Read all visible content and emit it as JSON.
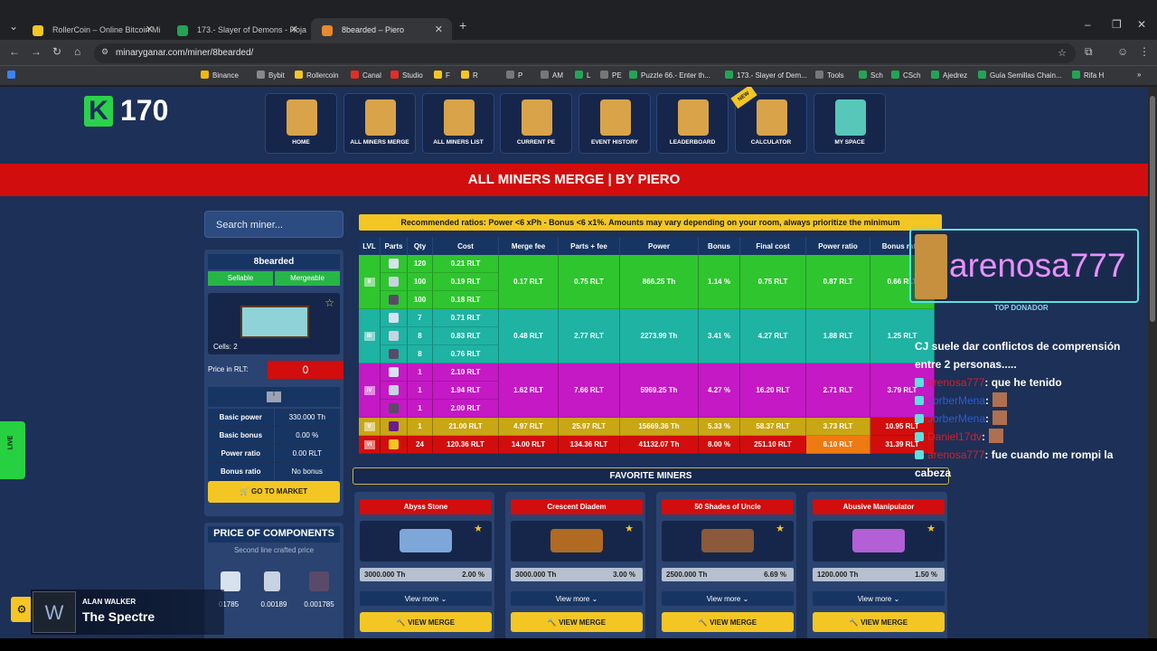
{
  "browser": {
    "tabs": [
      {
        "label": "RollerCoin – Online Bitcoin Mi",
        "color": "#f3c623"
      },
      {
        "label": "173.- Slayer of Demons - Hoja",
        "color": "#23a455"
      },
      {
        "label": "8bearded – Piero",
        "color": "#e8892f"
      }
    ],
    "url": "minaryganar.com/miner/8bearded/",
    "bookmarks": [
      "Binance",
      "Bybit",
      "Rollercoin",
      "Canal",
      "Studio",
      "F",
      "R",
      "P",
      "AM",
      "L",
      "PE",
      "Puzzle 66.- Enter th...",
      "173.- Slayer of Dem...",
      "Tools",
      "Sch",
      "CSch",
      "Ajedrez",
      "Guía Semillas Chain...",
      "Rifa H"
    ]
  },
  "logo": {
    "number": "170"
  },
  "nav": [
    {
      "label": "HOME"
    },
    {
      "label": "ALL MINERS MERGE"
    },
    {
      "label": "ALL MINERS LIST"
    },
    {
      "label": "CURRENT PE"
    },
    {
      "label": "EVENT HISTORY"
    },
    {
      "label": "LEADERBOARD"
    },
    {
      "label": "CALCULATOR"
    },
    {
      "label": "MY SPACE"
    }
  ],
  "new_tag": "NEW",
  "banner": "ALL MINERS MERGE | BY PIERO",
  "search": {
    "placeholder": "Search miner..."
  },
  "miner": {
    "name": "8bearded",
    "sellable": "Sellable",
    "mergeable": "Mergeable",
    "cells": "Cells: 2",
    "price_label": "Price in RLT:",
    "price": "0",
    "level_badge": "I",
    "stats": [
      {
        "label": "Basic power",
        "value": "330.000 Th"
      },
      {
        "label": "Basic bonus",
        "value": "0.00 %"
      },
      {
        "label": "Power ratio",
        "value": "0.00 RLT"
      },
      {
        "label": "Bonus ratio",
        "value": "No bonus"
      }
    ],
    "go_market": "GO TO MARKET"
  },
  "components": {
    "title": "PRICE OF COMPONENTS",
    "subtitle": "Second line crafted price",
    "values": [
      "01785",
      "0.00189",
      "0.001785"
    ]
  },
  "recommended": "Recommended ratios: Power <6 xPh - Bonus <6 x1%. Amounts may vary depending on your room, always prioritize the minimum",
  "table": {
    "headers": [
      "LVL",
      "Parts",
      "Qty",
      "Cost",
      "Merge fee",
      "Parts + fee",
      "Power",
      "Bonus",
      "Final cost",
      "Power ratio",
      "Bonus ratio"
    ],
    "groups": [
      {
        "color": "#2fc52f",
        "lvl": "II",
        "rows": [
          [
            "120",
            "0.21 RLT"
          ],
          [
            "100",
            "0.19 RLT"
          ],
          [
            "100",
            "0.18 RLT"
          ]
        ],
        "merge_fee": "0.17 RLT",
        "parts_fee": "0.75 RLT",
        "power": "866.25 Th",
        "bonus": "1.14 %",
        "final": "0.75 RLT",
        "pratio": "0.87 RLT",
        "bratio": "0.66 RLT"
      },
      {
        "color": "#1eb3a3",
        "lvl": "III",
        "rows": [
          [
            "7",
            "0.71 RLT"
          ],
          [
            "8",
            "0.83 RLT"
          ],
          [
            "8",
            "0.76 RLT"
          ]
        ],
        "merge_fee": "0.48 RLT",
        "parts_fee": "2.77 RLT",
        "power": "2273.99 Th",
        "bonus": "3.41 %",
        "final": "4.27 RLT",
        "pratio": "1.88 RLT",
        "bratio": "1.25 RLT"
      },
      {
        "color": "#c419c4",
        "lvl": "IV",
        "rows": [
          [
            "1",
            "2.10 RLT"
          ],
          [
            "1",
            "1.94 RLT"
          ],
          [
            "1",
            "2.00 RLT"
          ]
        ],
        "merge_fee": "1.62 RLT",
        "parts_fee": "7.66 RLT",
        "power": "5969.25 Th",
        "bonus": "4.27 %",
        "final": "16.20 RLT",
        "pratio": "2.71 RLT",
        "bratio": "3.79 RLT"
      }
    ],
    "single_rows": [
      {
        "color": "#c9a614",
        "lvl": "V",
        "qty": "1",
        "cost": "21.00 RLT",
        "merge_fee": "4.97 RLT",
        "parts_fee": "25.97 RLT",
        "power": "15669.36 Th",
        "bonus": "5.33 %",
        "final": "58.37 RLT",
        "pratio": "3.73 RLT",
        "bratio": "10.95 RLT",
        "pratio_color": "#c9a614",
        "bratio_color": "#d20d0d"
      },
      {
        "color": "#d20d0d",
        "lvl": "VI",
        "qty": "24",
        "cost": "120.36 RLT",
        "merge_fee": "14.00 RLT",
        "parts_fee": "134.36 RLT",
        "power": "41132.07 Th",
        "bonus": "8.00 %",
        "final": "251.10 RLT",
        "pratio": "6.10 RLT",
        "bratio": "31.39 RLT",
        "pratio_color": "#ef7a12",
        "bratio_color": "#d20d0d"
      }
    ]
  },
  "favorites": {
    "title": "FAVORITE MINERS",
    "cards": [
      {
        "name": "Abyss Stone",
        "power": "3000.000 Th",
        "bonus": "2.00 %",
        "img": "#7fa6d9"
      },
      {
        "name": "Crescent Diadem",
        "power": "3000.000 Th",
        "bonus": "3.00 %",
        "img": "#b06a22"
      },
      {
        "name": "50 Shades of Uncle",
        "power": "2500.000 Th",
        "bonus": "6.69 %",
        "img": "#8a5a3a"
      },
      {
        "name": "Abusive Manipulator",
        "power": "1200.000 Th",
        "bonus": "1.50 %",
        "img": "#b35fd6"
      }
    ],
    "view_more": "View more",
    "view_merge": "VIEW MERGE"
  },
  "overlay": {
    "live": "LIVE",
    "donor_name": "arenosa777",
    "donor_tag": "TOP DONADOR",
    "chat": [
      {
        "type": "text",
        "text": "CJ suele dar conflictos de comprensión entre 2 personas....."
      },
      {
        "type": "msg",
        "user": "arenosa777",
        "ucolor": "red",
        "text": ": que he tenido"
      },
      {
        "type": "msg",
        "user": "JorberMena",
        "ucolor": "blue",
        "text": ":"
      },
      {
        "type": "msg",
        "user": "JorberMena",
        "ucolor": "blue",
        "text": ":"
      },
      {
        "type": "msg",
        "user": "Daniel17dv",
        "ucolor": "red",
        "text": ":"
      },
      {
        "type": "msg",
        "user": "arenosa777",
        "ucolor": "red",
        "text": ": fue cuando me rompi la cabeza"
      }
    ],
    "now_playing": {
      "artist": "ALAN WALKER",
      "song": "The Spectre"
    }
  }
}
